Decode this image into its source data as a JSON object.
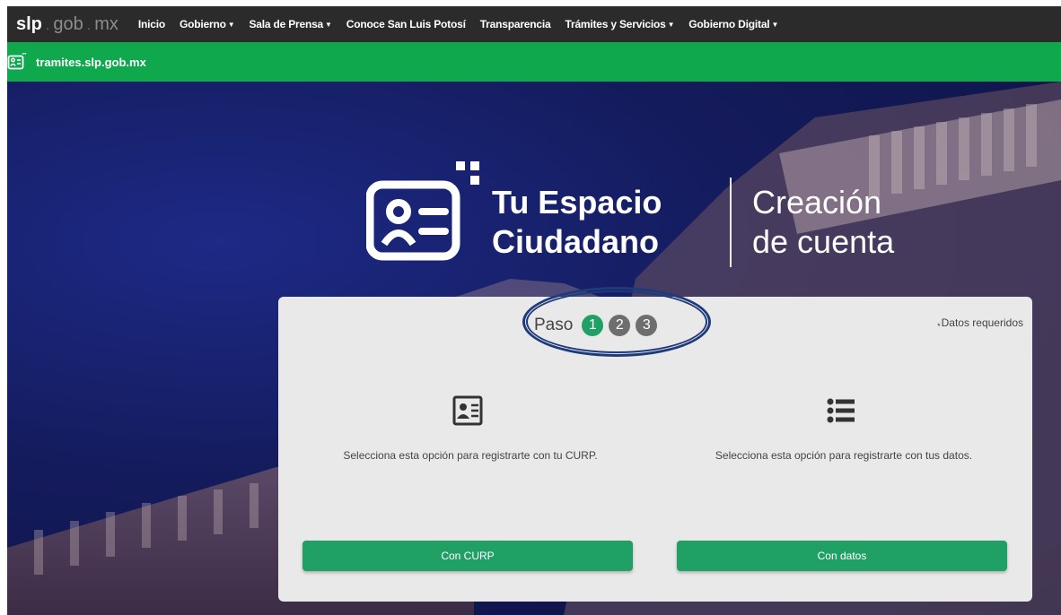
{
  "brand": {
    "part1": "slp",
    "part2": "gob",
    "part3": "mx"
  },
  "nav": [
    {
      "label": "Inicio",
      "dropdown": false
    },
    {
      "label": "Gobierno",
      "dropdown": true
    },
    {
      "label": "Sala de Prensa",
      "dropdown": true
    },
    {
      "label": "Conoce San Luis Potosí",
      "dropdown": false
    },
    {
      "label": "Transparencia",
      "dropdown": false
    },
    {
      "label": "Trámites y Servicios",
      "dropdown": true
    },
    {
      "label": "Gobierno Digital",
      "dropdown": true
    }
  ],
  "sitebar": {
    "icon": "citizen-id-icon",
    "text": "tramites.slp.gob.mx"
  },
  "hero": {
    "title_line1": "Tu Espacio",
    "title_line2": "Ciudadano",
    "subtitle_line1": "Creación",
    "subtitle_line2": "de cuenta"
  },
  "card": {
    "paso_label": "Paso",
    "steps": [
      "1",
      "2",
      "3"
    ],
    "active_step": "1",
    "required_note": "Datos requeridos",
    "options": [
      {
        "icon": "id-card-icon",
        "text": "Selecciona esta opción para registrarte con tu CURP.",
        "button": "Con CURP"
      },
      {
        "icon": "list-icon",
        "text": "Selecciona esta opción para registrarte con tus datos.",
        "button": "Con datos"
      }
    ]
  },
  "colors": {
    "green_bar": "#0fa84d",
    "button": "#21a066",
    "nav_bg": "#2b2b2b",
    "highlight": "#1f3a7a"
  }
}
